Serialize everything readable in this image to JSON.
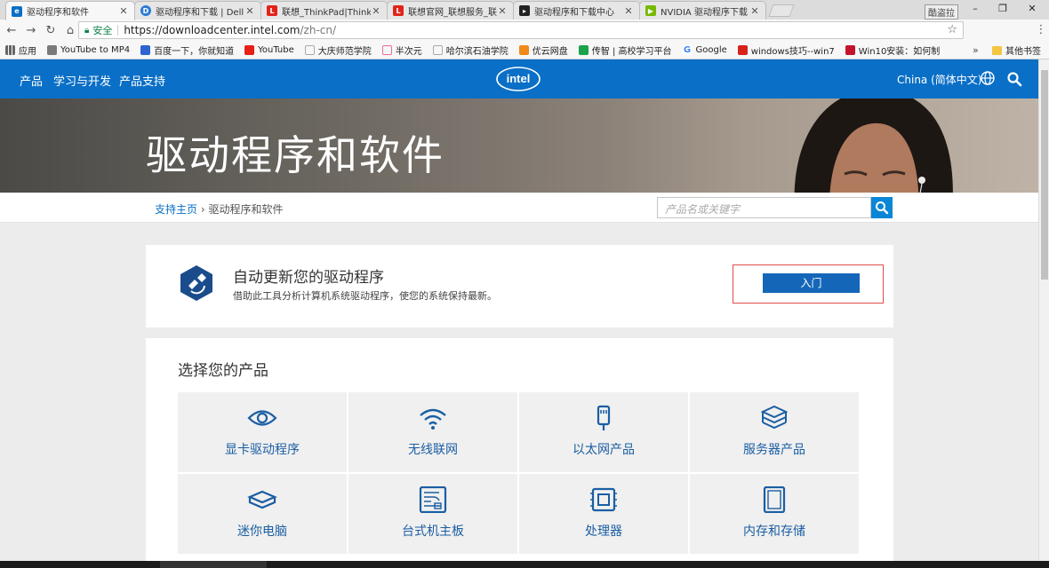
{
  "browser": {
    "tabs": [
      {
        "title": "驱动程序和软件",
        "active": true
      },
      {
        "title": "驱动程序和下载 | Dell 中"
      },
      {
        "title": "联想_ThinkPad|ThinkCe"
      },
      {
        "title": "联想官网_联想服务_联想"
      },
      {
        "title": "驱动程序和下载中心"
      },
      {
        "title": "NVIDIA 驱动程序下载"
      }
    ],
    "profile_name": "酷盗拉",
    "window_buttons": {
      "minimize": "–",
      "restore": "❐",
      "close": "✕"
    },
    "address": {
      "secure_label": "安全",
      "url_host": "https://downloadcenter.intel.com",
      "url_path": "/zh-cn/"
    },
    "bookmarks": [
      {
        "label": "应用",
        "color": "#666666"
      },
      {
        "label": "YouTube to MP4",
        "color": "#7a7a7a"
      },
      {
        "label": "百度一下，你就知道",
        "color": "#2e63d0"
      },
      {
        "label": "YouTube",
        "color": "#e62117"
      },
      {
        "label": "大庆师范学院",
        "color": "#aaaaaa"
      },
      {
        "label": "半次元",
        "color": "#f06aa0"
      },
      {
        "label": "哈尔滨石油学院",
        "color": "#aaaaaa"
      },
      {
        "label": "优云网盘",
        "color": "#f08a18"
      },
      {
        "label": "传智 | 高校学习平台",
        "color": "#1aa34a"
      },
      {
        "label": "Google",
        "color": "#4285f4"
      },
      {
        "label": "windows技巧--win7",
        "color": "#d8231a"
      },
      {
        "label": "Win10安装：如何制",
        "color": "#c4142b"
      }
    ],
    "bookmarks_more": "»",
    "other_bookmarks": "其他书签"
  },
  "site": {
    "nav": {
      "products": "产品",
      "learn": "学习与开发",
      "support": "产品支持"
    },
    "logo_text": "intel",
    "region": "China (简体中文)",
    "hero_title": "驱动程序和软件",
    "breadcrumb": {
      "home": "支持主页",
      "separator": " › ",
      "current": "驱动程序和软件"
    },
    "search_placeholder": "产品名或关键字",
    "update": {
      "title": "自动更新您的驱动程序",
      "description": "借助此工具分析计算机系统驱动程序，使您的系统保持最新。",
      "button": "入门"
    },
    "products": {
      "heading": "选择您的产品",
      "items": [
        {
          "label": "显卡驱动程序",
          "icon": "eye-icon"
        },
        {
          "label": "无线联网",
          "icon": "wifi-icon"
        },
        {
          "label": "以太网产品",
          "icon": "ethernet-icon"
        },
        {
          "label": "服务器产品",
          "icon": "server-icon"
        },
        {
          "label": "迷你电脑",
          "icon": "mini-pc-icon"
        },
        {
          "label": "台式机主板",
          "icon": "motherboard-icon"
        },
        {
          "label": "处理器",
          "icon": "processor-icon"
        },
        {
          "label": "内存和存储",
          "icon": "storage-icon"
        }
      ]
    }
  },
  "colors": {
    "intel_blue": "#0a6fc6",
    "link": "#1b5ea3",
    "button": "#1467b8",
    "highlight": "#e14b4b"
  }
}
